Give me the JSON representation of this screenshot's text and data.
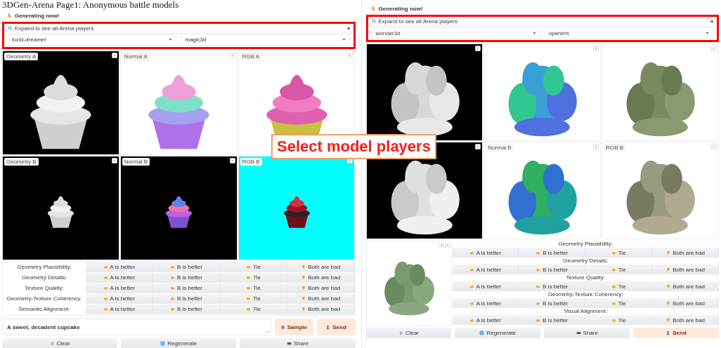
{
  "title": "3DGen-Arena Page1: Anonymous battle models",
  "panels": [
    {
      "kind": "text-prompt",
      "heading": "Generating now!",
      "accordion": "Expand to see all Arena players",
      "model_a": "lucid-dreamer",
      "model_b": "magic3d",
      "viewers": [
        {
          "kind": "picture",
          "label": "Geometry A"
        },
        {
          "kind": "picture",
          "label": "Normal A"
        },
        {
          "kind": "picture",
          "label": "RGB A"
        },
        {
          "kind": "picture",
          "label": "Geometry B"
        },
        {
          "kind": "picture",
          "label": "Normal B"
        },
        {
          "kind": "picture",
          "label": "RGB B"
        }
      ],
      "criteria": [
        {
          "label": "Geometry Plausibility:",
          "options": [
            {
              "kind": "a",
              "label": "A is better"
            },
            {
              "kind": "b",
              "label": "B is better"
            },
            {
              "kind": "tie",
              "label": "Tie"
            },
            {
              "kind": "bad",
              "label": "Both are bad"
            }
          ]
        },
        {
          "label": "Geometry Details:",
          "options": [
            {
              "kind": "a",
              "label": "A is better"
            },
            {
              "kind": "b",
              "label": "B is better"
            },
            {
              "kind": "tie",
              "label": "Tie"
            },
            {
              "kind": "bad",
              "label": "Both are bad"
            }
          ]
        },
        {
          "label": "Texture Quality:",
          "options": [
            {
              "kind": "a",
              "label": "A is better"
            },
            {
              "kind": "b",
              "label": "B is better"
            },
            {
              "kind": "tie",
              "label": "Tie"
            },
            {
              "kind": "bad",
              "label": "Both are bad"
            }
          ]
        },
        {
          "label": "Geometry-Texture Coherency:",
          "options": [
            {
              "kind": "a",
              "label": "A is better"
            },
            {
              "kind": "b",
              "label": "B is better"
            },
            {
              "kind": "tie",
              "label": "Tie"
            },
            {
              "kind": "bad",
              "label": "Both are bad"
            }
          ]
        },
        {
          "label": "Semantic Alignment:",
          "options": [
            {
              "kind": "a",
              "label": "A is better"
            },
            {
              "kind": "b",
              "label": "B is better"
            },
            {
              "kind": "tie",
              "label": "Tie"
            },
            {
              "kind": "bad",
              "label": "Both are bad"
            }
          ]
        }
      ],
      "prompt": {
        "value": "A sweet, decadent cupcake"
      },
      "prompt_buttons": [
        {
          "kind": "sample",
          "label": "Sample"
        },
        {
          "kind": "send",
          "label": "Send"
        }
      ],
      "actions": [
        {
          "kind": "clear",
          "label": "Clear"
        },
        {
          "kind": "regenerate",
          "label": "Regenerate"
        },
        {
          "kind": "share",
          "label": "Share"
        }
      ]
    },
    {
      "kind": "image-prompt",
      "heading": "Generating now!",
      "accordion": "Expand to see all Arena players",
      "model_a": "wonder3d",
      "model_b": "openlrm",
      "viewers": [
        {
          "kind": "picture"
        },
        {
          "kind": "picture"
        },
        {
          "kind": "picture"
        },
        {
          "kind": "picture"
        },
        {
          "kind": "picture",
          "label": "Normal B"
        },
        {
          "kind": "picture",
          "label": "RGB B"
        }
      ],
      "input_image": {
        "kind": "picture"
      },
      "criteria": [
        {
          "label": "Geometry Plausibility:",
          "options": [
            {
              "kind": "a",
              "label": "A is better"
            },
            {
              "kind": "b",
              "label": "B is better"
            },
            {
              "kind": "tie",
              "label": "Tie"
            },
            {
              "kind": "bad",
              "label": "Both are bad"
            }
          ]
        },
        {
          "label": "Geometry Details:",
          "options": [
            {
              "kind": "a",
              "label": "A is better"
            },
            {
              "kind": "b",
              "label": "B is better"
            },
            {
              "kind": "tie",
              "label": "Tie"
            },
            {
              "kind": "bad",
              "label": "Both are bad"
            }
          ]
        },
        {
          "label": "Texture Quality:",
          "options": [
            {
              "kind": "a",
              "label": "A is better"
            },
            {
              "kind": "b",
              "label": "B is better"
            },
            {
              "kind": "tie",
              "label": "Tie"
            },
            {
              "kind": "bad",
              "label": "Both are bad"
            }
          ]
        },
        {
          "label": "Geometry-Texture Coherency:",
          "options": [
            {
              "kind": "a",
              "label": "A is better"
            },
            {
              "kind": "b",
              "label": "B is better"
            },
            {
              "kind": "tie",
              "label": "Tie"
            },
            {
              "kind": "bad",
              "label": "Both are bad"
            }
          ]
        },
        {
          "label": "Visual Alignment:",
          "options": [
            {
              "kind": "a",
              "label": "A is better"
            },
            {
              "kind": "b",
              "label": "B is better"
            },
            {
              "kind": "tie",
              "label": "Tie"
            },
            {
              "kind": "bad",
              "label": "Both are bad"
            }
          ]
        }
      ],
      "actions": [
        {
          "kind": "clear",
          "label": "Clear"
        },
        {
          "kind": "regenerate",
          "label": "Regenerate"
        },
        {
          "kind": "share",
          "label": "Share"
        },
        {
          "kind": "send",
          "label": "Send"
        }
      ]
    }
  ],
  "callout": "Select model players"
}
